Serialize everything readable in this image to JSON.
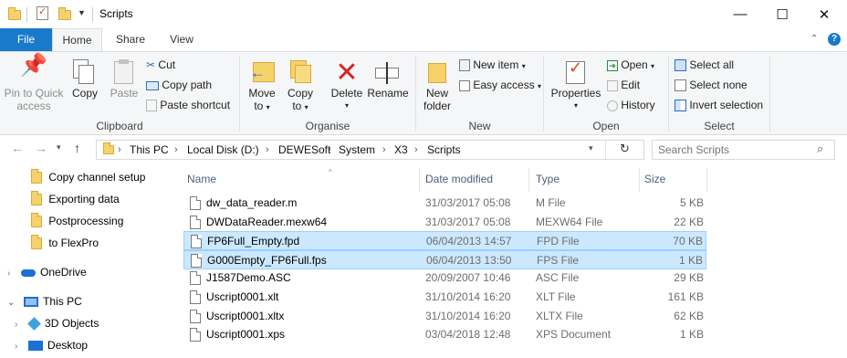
{
  "window": {
    "title": "Scripts",
    "minimize_glyph": "—",
    "maximize_glyph": "☐",
    "close_glyph": "✕"
  },
  "ribbon_tabs": [
    "File",
    "Home",
    "Share",
    "View"
  ],
  "ribbon": {
    "clipboard": {
      "pin": "Pin to Quick access",
      "pin_l1": "Pin to Quick",
      "pin_l2": "access",
      "copy": "Copy",
      "paste": "Paste",
      "cut": "Cut",
      "copy_path": "Copy path",
      "paste_shortcut": "Paste shortcut",
      "label": "Clipboard"
    },
    "organise": {
      "move_l1": "Move",
      "move_l2": "to",
      "copy_l1": "Copy",
      "copy_l2": "to",
      "delete": "Delete",
      "rename": "Rename",
      "label": "Organise"
    },
    "new": {
      "folder_l1": "New",
      "folder_l2": "folder",
      "new_item": "New item",
      "easy_access": "Easy access",
      "label": "New"
    },
    "open": {
      "properties": "Properties",
      "open": "Open",
      "edit": "Edit",
      "history": "History",
      "label": "Open"
    },
    "select": {
      "select_all": "Select all",
      "select_none": "Select none",
      "invert": "Invert selection",
      "label": "Select"
    }
  },
  "address": {
    "crumbs": [
      "This PC",
      "Local Disk (D:)",
      "DEWESoft",
      "System",
      "X3",
      "Scripts"
    ],
    "search_placeholder": "Search Scripts"
  },
  "nav_pane": [
    {
      "label": "Copy channel setup",
      "icon": "folder-icon"
    },
    {
      "label": "Exporting data",
      "icon": "folder-icon"
    },
    {
      "label": "Postprocessing",
      "icon": "folder-icon"
    },
    {
      "label": "to FlexPro",
      "icon": "folder-icon"
    },
    {
      "label": "OneDrive",
      "icon": "cloud-icon"
    },
    {
      "label": "This PC",
      "icon": "computer-icon"
    },
    {
      "label": "3D Objects",
      "icon": "cube-icon"
    },
    {
      "label": "Desktop",
      "icon": "desktop-icon"
    }
  ],
  "columns": [
    "Name",
    "Date modified",
    "Type",
    "Size"
  ],
  "files": [
    {
      "name": "dw_data_reader.m",
      "date": "31/03/2017 05:08",
      "type": "M File",
      "size": "5 KB",
      "selected": false
    },
    {
      "name": "DWDataReader.mexw64",
      "date": "31/03/2017 05:08",
      "type": "MEXW64 File",
      "size": "22 KB",
      "selected": false
    },
    {
      "name": "FP6Full_Empty.fpd",
      "date": "06/04/2013 14:57",
      "type": "FPD File",
      "size": "70 KB",
      "selected": true
    },
    {
      "name": "G000Empty_FP6Full.fps",
      "date": "06/04/2013 13:50",
      "type": "FPS File",
      "size": "1 KB",
      "selected": true
    },
    {
      "name": "J1587Demo.ASC",
      "date": "20/09/2007 10:46",
      "type": "ASC File",
      "size": "29 KB",
      "selected": false
    },
    {
      "name": "Uscript0001.xlt",
      "date": "31/10/2014 16:20",
      "type": "XLT File",
      "size": "161 KB",
      "selected": false
    },
    {
      "name": "Uscript0001.xltx",
      "date": "31/10/2014 16:20",
      "type": "XLTX File",
      "size": "62 KB",
      "selected": false
    },
    {
      "name": "Uscript0001.xps",
      "date": "03/04/2018 12:48",
      "type": "XPS Document",
      "size": "1 KB",
      "selected": false
    }
  ]
}
